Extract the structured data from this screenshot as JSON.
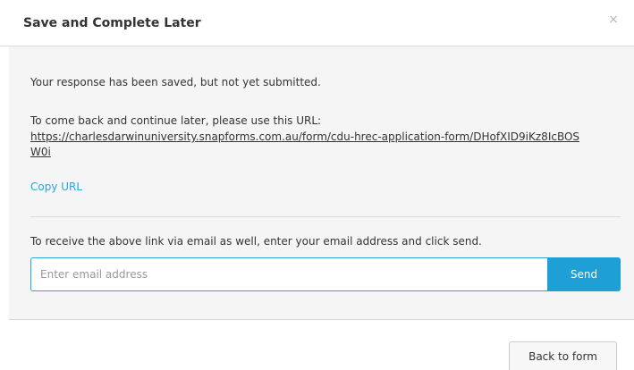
{
  "modal": {
    "title": "Save and Complete Later",
    "close_glyph": "×"
  },
  "body": {
    "saved_message": "Your response has been saved, but not yet submitted.",
    "later_message": "To come back and continue later, please use this URL:",
    "resume_url": "https://charlesdarwinuniversity.snapforms.com.au/form/cdu-hrec-application-form/DHofXID9iKz8IcBOSW0i",
    "copy_url_label": "Copy URL",
    "email_message": "To receive the above link via email as well, enter your email address and click send.",
    "email_placeholder": "Enter email address",
    "email_value": "",
    "send_label": "Send"
  },
  "footer": {
    "back_label": "Back to form"
  },
  "colors": {
    "accent": "#1e9fd6",
    "link": "#2aa7d8",
    "body_background": "#f5f5f5"
  },
  "icons": {
    "close": "close-icon"
  }
}
